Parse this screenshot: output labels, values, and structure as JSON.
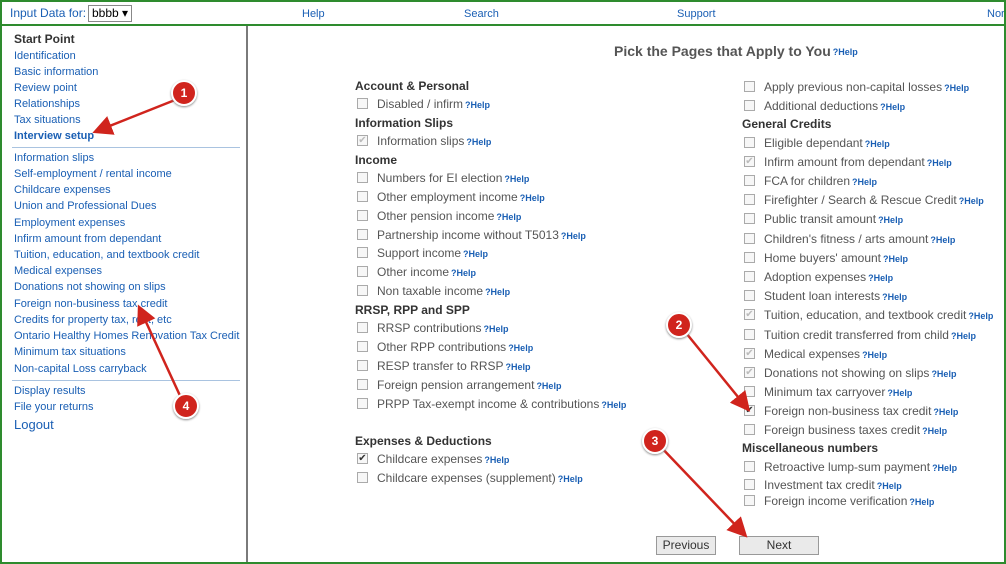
{
  "topbar": {
    "input_label": "Input Data for:",
    "year_value": "bbbb ▾",
    "links": [
      "Help",
      "Search",
      "Support",
      "Nor"
    ]
  },
  "sidebar": {
    "start_point": "Start Point",
    "group1": [
      "Identification",
      "Basic information",
      "Review point",
      "Relationships",
      "Tax situations",
      "Interview setup"
    ],
    "group2": [
      "Information slips",
      "Self-employment / rental income",
      "Childcare expenses",
      "Union and Professional Dues",
      "Employment expenses",
      "Infirm amount from dependant",
      "Tuition, education, and textbook credit",
      "Medical expenses",
      "Donations not showing on slips",
      "Foreign non-business tax credit",
      "Credits for property tax, rent, etc",
      "Ontario Healthy Homes Renovation Tax Credit",
      "Minimum tax situations",
      "Non-capital Loss carryback"
    ],
    "group3": [
      "Display results",
      "File your returns"
    ],
    "logout": "Logout"
  },
  "main": {
    "title": "Pick the Pages that Apply to You",
    "help_label": "?Help",
    "left_sections": [
      {
        "heading": "Account & Personal",
        "items": [
          {
            "label": "Disabled / infirm",
            "state": "unchecked"
          }
        ]
      },
      {
        "heading": "Information Slips",
        "items": [
          {
            "label": "Information slips",
            "state": "disabled"
          }
        ]
      },
      {
        "heading": "Income",
        "items": [
          {
            "label": "Numbers for EI election",
            "state": "unchecked"
          },
          {
            "label": "Other employment income",
            "state": "unchecked"
          },
          {
            "label": "Other pension income",
            "state": "unchecked"
          },
          {
            "label": "Partnership income without T5013",
            "state": "unchecked"
          },
          {
            "label": "Support income",
            "state": "unchecked"
          },
          {
            "label": "Other income",
            "state": "unchecked"
          },
          {
            "label": "Non taxable income",
            "state": "unchecked"
          }
        ]
      },
      {
        "heading": "RRSP, RPP and SPP",
        "items": [
          {
            "label": "RRSP contributions",
            "state": "unchecked"
          },
          {
            "label": "Other RPP contributions",
            "state": "unchecked"
          },
          {
            "label": "RESP transfer to RRSP",
            "state": "unchecked"
          },
          {
            "label": "Foreign pension arrangement",
            "state": "unchecked"
          },
          {
            "label": "PRPP Tax-exempt income & contributions",
            "state": "unchecked"
          }
        ]
      },
      {
        "heading": "Expenses & Deductions",
        "items": [
          {
            "label": "Childcare expenses",
            "state": "checked"
          },
          {
            "label": "Childcare expenses (supplement)",
            "state": "unchecked"
          }
        ]
      }
    ],
    "right_top": [
      {
        "label": "Apply previous non-capital losses",
        "state": "unchecked"
      },
      {
        "label": "Additional deductions",
        "state": "unchecked"
      }
    ],
    "general_credits": {
      "heading": "General Credits",
      "items": [
        {
          "label": "Eligible dependant",
          "state": "unchecked"
        },
        {
          "label": "Infirm amount from dependant",
          "state": "disabled"
        },
        {
          "label": "FCA for children",
          "state": "unchecked"
        },
        {
          "label": "Firefighter / Search & Rescue Credit",
          "state": "unchecked"
        },
        {
          "label": "Public transit amount",
          "state": "unchecked"
        },
        {
          "label": "Children's fitness / arts amount",
          "state": "unchecked"
        },
        {
          "label": "Home buyers' amount",
          "state": "unchecked"
        },
        {
          "label": "Adoption expenses",
          "state": "unchecked"
        },
        {
          "label": "Student loan interests",
          "state": "unchecked"
        },
        {
          "label": "Tuition, education, and textbook credit",
          "state": "disabled"
        },
        {
          "label": "Tuition credit transferred from child",
          "state": "unchecked"
        },
        {
          "label": "Medical expenses",
          "state": "disabled"
        },
        {
          "label": "Donations not showing on slips",
          "state": "disabled"
        },
        {
          "label": "Minimum tax carryover",
          "state": "unchecked"
        },
        {
          "label": "Foreign non-business tax credit",
          "state": "checked"
        },
        {
          "label": "Foreign business taxes credit",
          "state": "unchecked"
        }
      ]
    },
    "misc": {
      "heading": "Miscellaneous numbers",
      "items": [
        {
          "label": "Retroactive lump-sum payment",
          "state": "unchecked"
        },
        {
          "label": "Investment tax credit",
          "state": "unchecked"
        },
        {
          "label": "Foreign income verification",
          "state": "unchecked"
        }
      ]
    },
    "buttons": {
      "previous": "Previous",
      "next": "Next"
    }
  },
  "annotations": {
    "markers": [
      "1",
      "2",
      "3",
      "4"
    ],
    "color": "#d0241d"
  }
}
